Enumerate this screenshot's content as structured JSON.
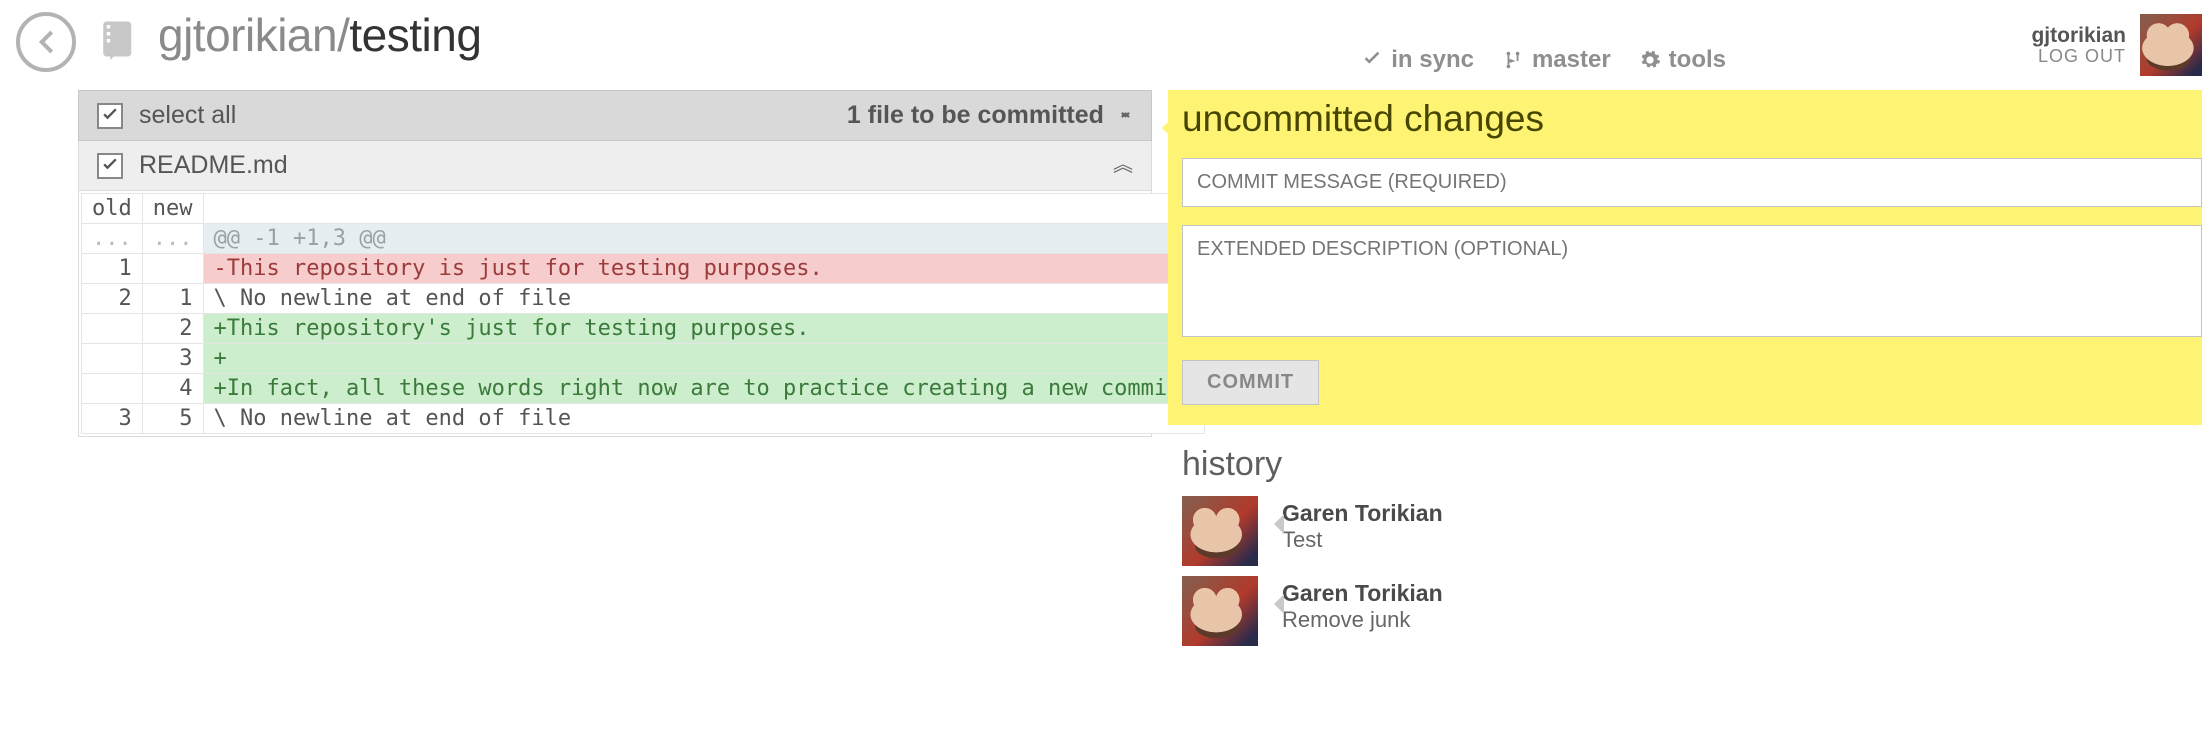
{
  "header": {
    "owner": "gjtorikian",
    "sep": "/",
    "repo": "testing",
    "tabs": {
      "sync": "in sync",
      "branch": "master",
      "tools": "tools"
    }
  },
  "user": {
    "name": "gjtorikian",
    "logout": "LOG OUT"
  },
  "changes": {
    "select_all": "select all",
    "summary": "1 file to be committed",
    "file": "README.md"
  },
  "diff": {
    "head_old": "old",
    "head_new": "new",
    "rows": [
      {
        "type": "hunk",
        "old": "...",
        "new": "...",
        "text": "@@ -1 +1,3 @@"
      },
      {
        "type": "del",
        "old": "1",
        "new": "",
        "text": "-This repository is just for testing purposes."
      },
      {
        "type": "ctx",
        "old": "2",
        "new": "1",
        "text": "\\ No newline at end of file"
      },
      {
        "type": "add",
        "old": "",
        "new": "2",
        "text": "+This repository's just for testing purposes."
      },
      {
        "type": "add",
        "old": "",
        "new": "3",
        "text": "+"
      },
      {
        "type": "add",
        "old": "",
        "new": "4",
        "text": "+In fact, all these words right now are to practice creating a new commit."
      },
      {
        "type": "ctx",
        "old": "3",
        "new": "5",
        "text": "\\ No newline at end of file"
      }
    ]
  },
  "commit_panel": {
    "title": "uncommitted changes",
    "message_ph": "COMMIT MESSAGE (REQUIRED)",
    "desc_ph": "EXTENDED DESCRIPTION (OPTIONAL)",
    "button": "COMMIT"
  },
  "history": {
    "title": "history",
    "items": [
      {
        "author": "Garen Torikian",
        "msg": "Test"
      },
      {
        "author": "Garen Torikian",
        "msg": "Remove junk"
      }
    ]
  }
}
